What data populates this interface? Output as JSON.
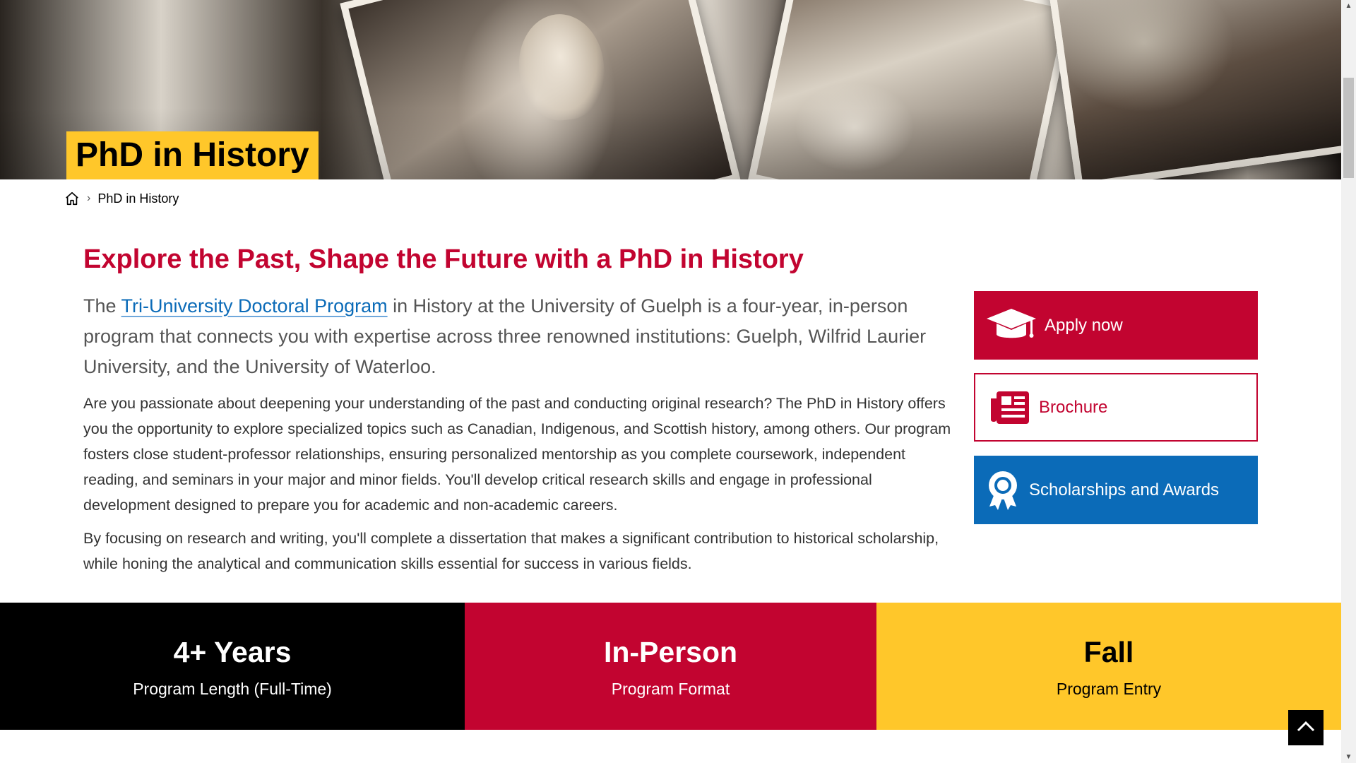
{
  "hero": {
    "title": "PhD in History"
  },
  "breadcrumb": {
    "home_icon": "home-icon",
    "current": "PhD in History"
  },
  "main": {
    "heading": "Explore the Past, Shape the Future with a PhD in History",
    "lead_prefix": "The ",
    "lead_link": "Tri-University Doctoral Program",
    "lead_suffix": " in History at the University of Guelph is a four-year, in-person program that connects you with expertise across three renowned institutions: Guelph, Wilfrid Laurier University, and the University of Waterloo.",
    "paragraph1": "Are you passionate about deepening your understanding of the past and conducting original research? The PhD in History offers you the opportunity to explore specialized topics such as Canadian, Indigenous, and Scottish history, among others. Our program fosters close student-professor relationships, ensuring personalized mentorship as you complete coursework, independent reading, and seminars in your major and minor fields. You'll develop critical research skills and engage in professional development designed to prepare you for academic and non-academic careers.",
    "paragraph2": "By focusing on research and writing, you'll complete a dissertation that makes a significant contribution to historical scholarship, while honing the analytical and communication skills essential for success in various fields."
  },
  "actions": {
    "apply": {
      "label": "Apply now",
      "icon": "graduation-cap-icon",
      "color": "#c20430"
    },
    "brochure": {
      "label": "Brochure",
      "icon": "newspaper-icon",
      "color": "#c20430"
    },
    "scholarships": {
      "label": "Scholarships and Awards",
      "icon": "award-ribbon-icon",
      "color": "#0b6bb8"
    }
  },
  "stats": [
    {
      "value": "4+ Years",
      "label": "Program Length (Full-Time)",
      "color": "#000000"
    },
    {
      "value": "In-Person",
      "label": "Program Format",
      "color": "#c20430"
    },
    {
      "value": "Fall",
      "label": "Program Entry",
      "color": "#ffc72a"
    }
  ],
  "back_to_top": {
    "icon": "chevron-up-icon"
  }
}
